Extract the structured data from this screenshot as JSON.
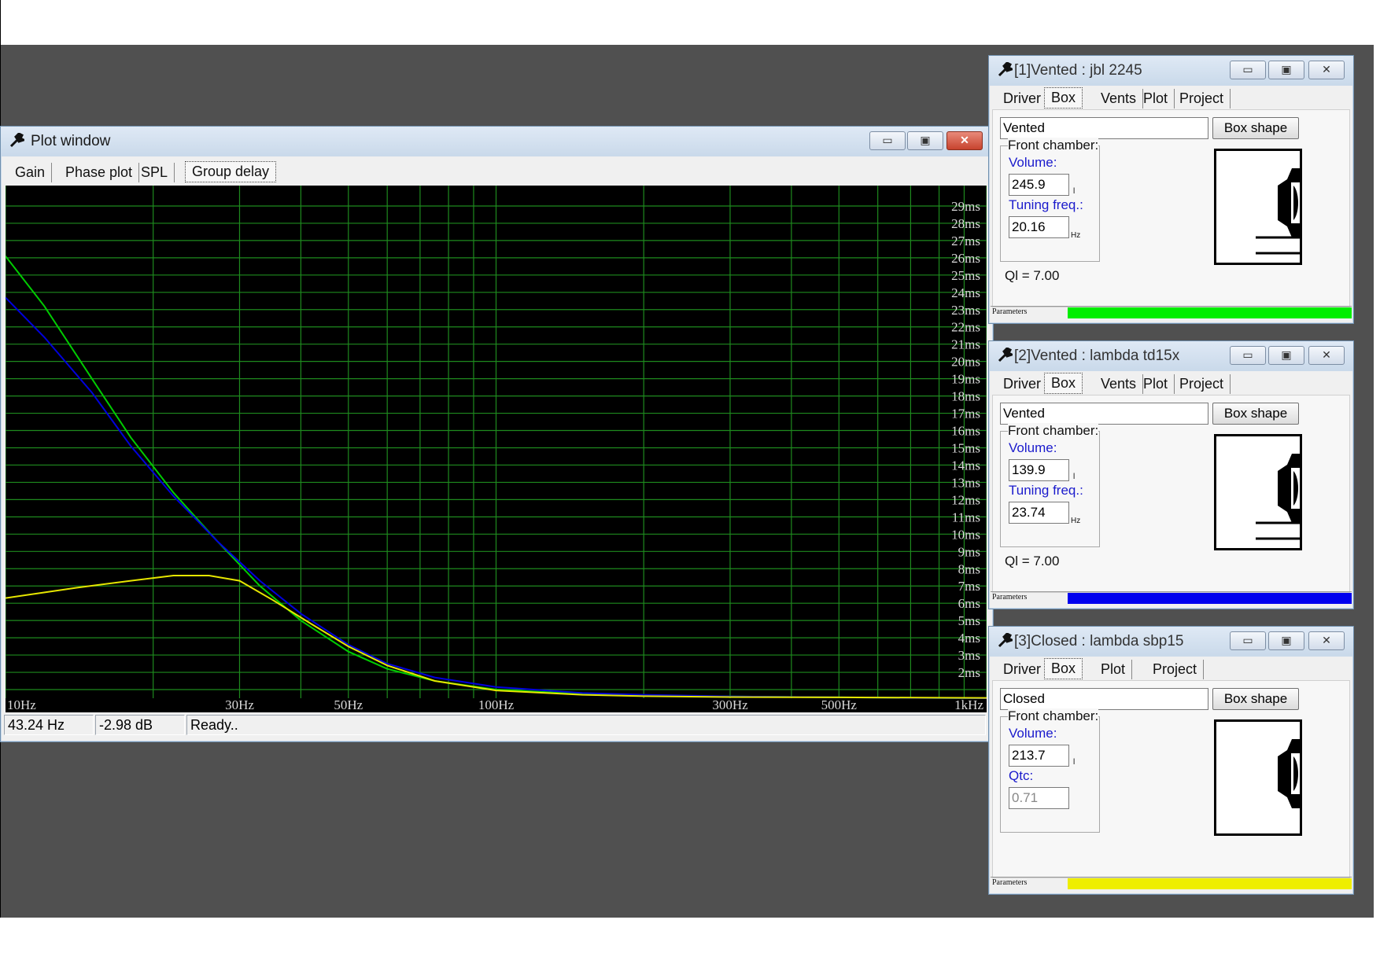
{
  "plot_window": {
    "title": "Plot window",
    "tabs": [
      "Gain",
      "Phase plot",
      "SPL",
      "Group delay"
    ],
    "active_tab": "Group delay",
    "status": {
      "frequency": "43.24 Hz",
      "level": "-2.98 dB",
      "message": "Ready.."
    },
    "caption_buttons": {
      "minimize": "▭",
      "maximize": "▣",
      "close": "✕"
    }
  },
  "chart_data": {
    "type": "line",
    "title": "",
    "xlabel": "",
    "ylabel": "",
    "x_scale": "log",
    "xlim": [
      10,
      1000
    ],
    "ylim": [
      0.5,
      30
    ],
    "grid": true,
    "x_tick_labels": [
      {
        "value": 10,
        "label": "10Hz"
      },
      {
        "value": 30,
        "label": "30Hz"
      },
      {
        "value": 50,
        "label": "50Hz"
      },
      {
        "value": 100,
        "label": "100Hz"
      },
      {
        "value": 300,
        "label": "300Hz"
      },
      {
        "value": 500,
        "label": "500Hz"
      },
      {
        "value": 1000,
        "label": "1kHz"
      }
    ],
    "y_tick_labels": [
      "2ms",
      "3ms",
      "4ms",
      "5ms",
      "6ms",
      "7ms",
      "8ms",
      "9ms",
      "10ms",
      "11ms",
      "12ms",
      "13ms",
      "14ms",
      "15ms",
      "16ms",
      "17ms",
      "18ms",
      "19ms",
      "20ms",
      "21ms",
      "22ms",
      "23ms",
      "24ms",
      "25ms",
      "26ms",
      "27ms",
      "28ms",
      "29ms"
    ],
    "y_tick_values": [
      2,
      3,
      4,
      5,
      6,
      7,
      8,
      9,
      10,
      11,
      12,
      13,
      14,
      15,
      16,
      17,
      18,
      19,
      20,
      21,
      22,
      23,
      24,
      25,
      26,
      27,
      28,
      29
    ],
    "series": [
      {
        "color": "#00cc00",
        "x": [
          10,
          12,
          15,
          18,
          22,
          27,
          33,
          40,
          50,
          60,
          75,
          100,
          150,
          200,
          300,
          500,
          1000
        ],
        "y": [
          26.1,
          23.2,
          19.0,
          15.6,
          12.4,
          9.6,
          7.0,
          5.0,
          3.2,
          2.2,
          1.5,
          1.0,
          0.75,
          0.65,
          0.6,
          0.55,
          0.5
        ]
      },
      {
        "color": "#0000dd",
        "x": [
          10,
          12,
          15,
          18,
          22,
          27,
          33,
          40,
          50,
          60,
          75,
          100,
          150,
          200,
          300,
          500,
          1000
        ],
        "y": [
          23.7,
          21.4,
          18.2,
          15.1,
          12.2,
          9.6,
          7.3,
          5.4,
          3.6,
          2.5,
          1.7,
          1.15,
          0.8,
          0.7,
          0.6,
          0.55,
          0.5
        ]
      },
      {
        "color": "#e6e600",
        "x": [
          10,
          14,
          18,
          22,
          26,
          30,
          35,
          42,
          50,
          60,
          75,
          100,
          150,
          200,
          300,
          500,
          1000
        ],
        "y": [
          6.3,
          6.9,
          7.3,
          7.6,
          7.6,
          7.3,
          6.2,
          4.8,
          3.5,
          2.4,
          1.5,
          0.95,
          0.7,
          0.62,
          0.57,
          0.55,
          0.52
        ]
      }
    ]
  },
  "panels": [
    {
      "title": "[1]Vented : jbl 2245",
      "tabs": [
        "Driver",
        "Box",
        "Vents",
        "Plot",
        "Project"
      ],
      "active_tab": "Box",
      "box_type": "Vented",
      "box_shape_button": "Box shape",
      "group_label": "Front chamber:",
      "field1_label": "Volume:",
      "field1_value": "245.9",
      "field1_unit": "l",
      "field2_label": "Tuning freq.:",
      "field2_value": "20.16",
      "field2_unit": "Hz",
      "ql": "Ql = 7.00",
      "params_label": "Parameters",
      "color": "#00ee00",
      "vented": true
    },
    {
      "title": "[2]Vented : lambda td15x",
      "tabs": [
        "Driver",
        "Box",
        "Vents",
        "Plot",
        "Project"
      ],
      "active_tab": "Box",
      "box_type": "Vented",
      "box_shape_button": "Box shape",
      "group_label": "Front chamber:",
      "field1_label": "Volume:",
      "field1_value": "139.9",
      "field1_unit": "l",
      "field2_label": "Tuning freq.:",
      "field2_value": "23.74",
      "field2_unit": "Hz",
      "ql": "Ql = 7.00",
      "params_label": "Parameters",
      "color": "#0000ee",
      "vented": true
    },
    {
      "title": "[3]Closed : lambda sbp15",
      "tabs": [
        "Driver",
        "Box",
        "Plot",
        "Project"
      ],
      "active_tab": "Box",
      "box_type": "Closed",
      "box_shape_button": "Box shape",
      "group_label": "Front chamber:",
      "field1_label": "Volume:",
      "field1_value": "213.7",
      "field1_unit": "l",
      "field2_label": "Qtc:",
      "field2_value": "0.71",
      "field2_unit": "",
      "ql": "",
      "params_label": "Parameters",
      "color": "#eeee00",
      "vented": false
    }
  ]
}
